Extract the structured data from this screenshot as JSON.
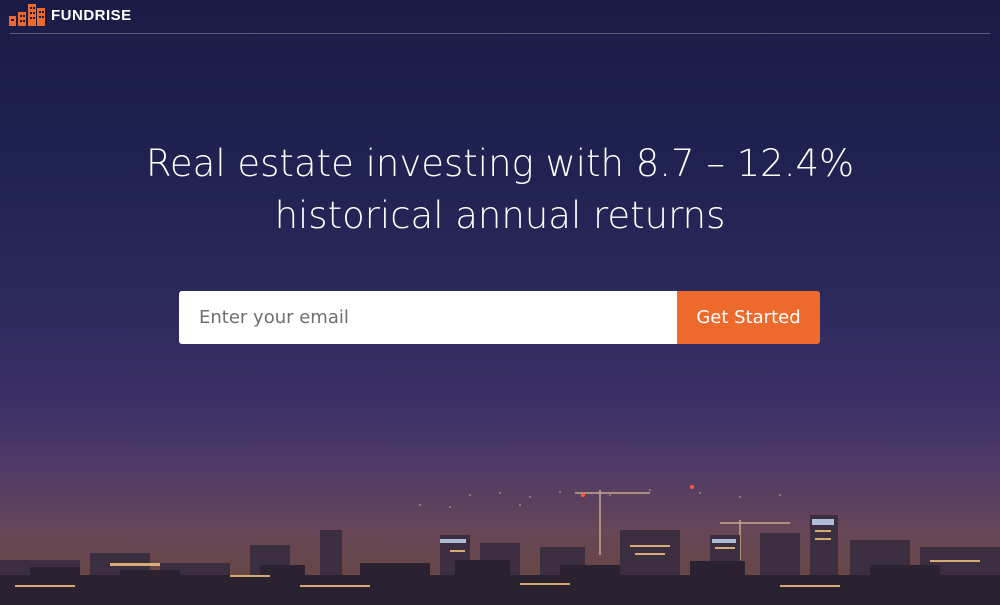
{
  "brand": {
    "name": "FUNDRISE",
    "accent_color": "#ee6a2c",
    "logo_icon": "buildings-icon"
  },
  "hero": {
    "title_line1": "Real estate investing with 8.7 – 12.4%",
    "title_line2": "historical annual returns"
  },
  "signup": {
    "email_placeholder": "Enter your email",
    "button_label": "Get Started",
    "button_color": "#ee6a2c"
  },
  "background": {
    "scene": "night-city-skyline"
  }
}
